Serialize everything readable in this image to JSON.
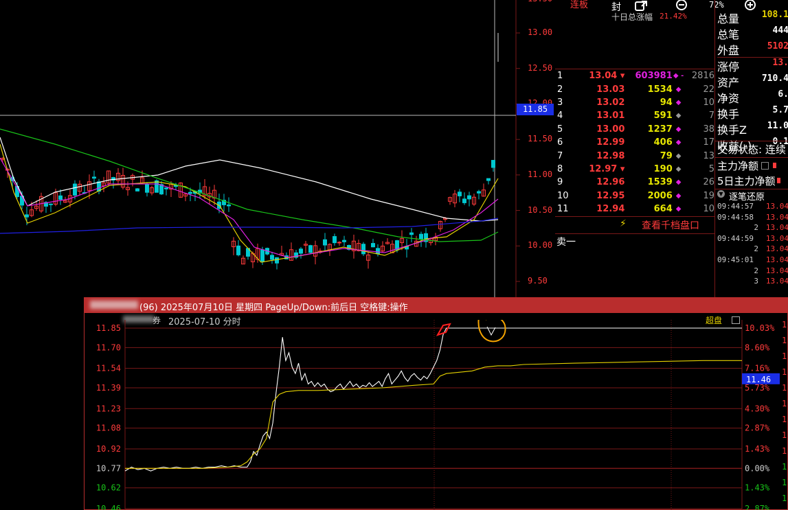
{
  "top_toolbar": {
    "seal_label": "封",
    "ten_day_label": "十日总涨幅",
    "ten_day_value": "21.42%",
    "zoom": "72%",
    "limit_up_tag": "连板"
  },
  "kline": {
    "y_ticks": [
      "13.00",
      "12.50",
      "12.00",
      "11.50",
      "11.00",
      "10.50",
      "10.00",
      "9.50"
    ],
    "cursor_price": "11.85",
    "top_cut_label": "13.50"
  },
  "order_book": {
    "rows": [
      {
        "idx": "1",
        "price": "13.04",
        "vol": "603981",
        "cnt": "2816",
        "highlight": true,
        "arrow": true
      },
      {
        "idx": "2",
        "price": "13.03",
        "vol": "1534",
        "cnt": "22"
      },
      {
        "idx": "3",
        "price": "13.02",
        "vol": "94",
        "cnt": "10"
      },
      {
        "idx": "4",
        "price": "13.01",
        "vol": "591",
        "cnt": "7"
      },
      {
        "idx": "5",
        "price": "13.00",
        "vol": "1237",
        "cnt": "38"
      },
      {
        "idx": "6",
        "price": "12.99",
        "vol": "406",
        "cnt": "17"
      },
      {
        "idx": "7",
        "price": "12.98",
        "vol": "79",
        "cnt": "13"
      },
      {
        "idx": "8",
        "price": "12.97",
        "vol": "190",
        "cnt": "5",
        "arrow": true
      },
      {
        "idx": "9",
        "price": "12.96",
        "vol": "1539",
        "cnt": "26"
      },
      {
        "idx": "10",
        "price": "12.95",
        "vol": "2006",
        "cnt": "19"
      },
      {
        "idx": "11",
        "price": "12.94",
        "vol": "664",
        "cnt": "10"
      }
    ],
    "view_depth_link": "查看千档盘口",
    "sell_one_label": "卖一"
  },
  "right_panel": {
    "rows": [
      {
        "label": "总量",
        "value": "108.1"
      },
      {
        "label": "总笔",
        "value": "444"
      },
      {
        "label": "外盘",
        "value": "5102"
      },
      {
        "label": "涨停",
        "value": "13."
      },
      {
        "label": "资产",
        "value": "710.4"
      },
      {
        "label": "净资",
        "value": "6."
      },
      {
        "label": "换手",
        "value": "5.7"
      },
      {
        "label": "换手Z",
        "value": "11.0"
      },
      {
        "label": "收益(-)",
        "value": "0.1"
      }
    ],
    "trade_status": "交易状态: 连续",
    "main_net": "主力净额",
    "main_net_5d": "5日主力净额",
    "tick_restore": "逐笔还原",
    "ticks": [
      {
        "time": "09:44:57",
        "price": "13.04"
      },
      {
        "time": "09:44:58",
        "price": "13.04"
      },
      {
        "time": "2",
        "price": "13.04"
      },
      {
        "time": "09:44:59",
        "price": "13.04"
      },
      {
        "time": "2",
        "price": "13.04"
      },
      {
        "time": "09:45:01",
        "price": "13.04"
      },
      {
        "time": "2",
        "price": "13.04"
      },
      {
        "time": "3",
        "price": "13.04"
      }
    ]
  },
  "popup": {
    "title": "(96) 2025年07月10日 星期四 PageUp/Down:前后日 空格键:操作",
    "subtitle_suffix": "券",
    "date_label": "2025-07-10 分时",
    "super_label": "超盘",
    "price_ticks": [
      "11.85",
      "11.70",
      "11.54",
      "11.39",
      "11.23",
      "11.08",
      "10.92",
      "10.77",
      "10.62",
      "10.46"
    ],
    "pct_ticks": [
      "10.03%",
      "8.60%",
      "7.16%",
      "5.73%",
      "4.30%",
      "2.87%",
      "1.43%",
      "0.00%",
      "1.43%",
      "2.87%"
    ],
    "last_price": "11.46",
    "right_edge_ticks": [
      "1",
      "1",
      "1",
      "1",
      "1",
      "1",
      "1",
      "1",
      "1",
      "1",
      "1",
      "1"
    ]
  },
  "chart_data": {
    "type": "line",
    "title": "2025-07-10 分时",
    "xlabel": "",
    "ylabel": "",
    "ylim": [
      10.46,
      11.85
    ],
    "prev_close": 10.77,
    "series": [
      {
        "name": "",
        "color": "#ffffff",
        "x": [
          0,
          10,
          20,
          30,
          40,
          50,
          60,
          70,
          80,
          90,
          100,
          110,
          120,
          130,
          140,
          150,
          160,
          170,
          180,
          190,
          195,
          200,
          205,
          210,
          215,
          220,
          225,
          230,
          235,
          240,
          245,
          250,
          255,
          260,
          265,
          270,
          275,
          280,
          285,
          290,
          295,
          300,
          305,
          310,
          315,
          320,
          325,
          330,
          335,
          340,
          345,
          350,
          355,
          360,
          365,
          370,
          375,
          380,
          385,
          390,
          395,
          400,
          405,
          410,
          415,
          420,
          425,
          430,
          435,
          440,
          445,
          450,
          455,
          460,
          465,
          470,
          475,
          480,
          485,
          490,
          495,
          500,
          505,
          510,
          515,
          520,
          525,
          530,
          535,
          540,
          545,
          550,
          555,
          560,
          565,
          570,
          575,
          580,
          585,
          590,
          595,
          600,
          610,
          620,
          630,
          640,
          650,
          660,
          670,
          680,
          690,
          700,
          710,
          720,
          730,
          740,
          750,
          760,
          770,
          780,
          790,
          800,
          810,
          820,
          830,
          840,
          850,
          860,
          870,
          880,
          890,
          900,
          910,
          920,
          930,
          940,
          950,
          960
        ],
        "y": [
          10.75,
          10.78,
          10.76,
          10.77,
          10.75,
          10.77,
          10.78,
          10.77,
          10.78,
          10.77,
          10.77,
          10.78,
          10.77,
          10.78,
          10.78,
          10.79,
          10.78,
          10.79,
          10.78,
          10.78,
          10.82,
          10.9,
          10.87,
          10.95,
          11.02,
          11.05,
          11.0,
          11.12,
          11.35,
          11.55,
          11.78,
          11.6,
          11.66,
          11.55,
          11.5,
          11.58,
          11.45,
          11.5,
          11.42,
          11.44,
          11.4,
          11.43,
          11.4,
          11.42,
          11.38,
          11.36,
          11.37,
          11.4,
          11.42,
          11.38,
          11.41,
          11.44,
          11.4,
          11.42,
          11.39,
          11.41,
          11.4,
          11.43,
          11.4,
          11.42,
          11.44,
          11.4,
          11.46,
          11.5,
          11.42,
          11.45,
          11.48,
          11.52,
          11.47,
          11.44,
          11.48,
          11.5,
          11.47,
          11.45,
          11.48,
          11.46,
          11.5,
          11.55,
          11.6,
          11.68,
          11.8,
          11.85,
          11.85,
          11.85,
          11.85,
          11.85,
          11.85,
          11.85,
          11.85,
          11.85,
          11.85,
          11.85,
          11.85,
          11.85,
          11.85,
          11.85,
          11.85,
          11.85,
          11.85,
          11.85,
          11.85,
          11.85,
          11.85,
          11.85,
          11.85,
          11.85,
          11.85,
          11.85,
          11.85,
          11.85,
          11.85,
          11.85,
          11.85,
          11.85,
          11.85,
          11.85,
          11.85,
          11.85,
          11.85,
          11.85,
          11.85,
          11.85,
          11.85,
          11.85,
          11.85,
          11.85,
          11.85,
          11.85,
          11.85,
          11.85,
          11.85,
          11.85,
          11.85,
          11.85,
          11.85,
          11.85,
          11.85,
          11.85
        ]
      },
      {
        "name": "",
        "color": "#e6d200",
        "x": [
          0,
          40,
          80,
          120,
          160,
          180,
          190,
          200,
          210,
          220,
          230,
          240,
          250,
          270,
          300,
          350,
          400,
          450,
          480,
          490,
          500,
          520,
          540,
          560,
          580,
          600,
          620,
          700,
          800,
          900,
          960
        ],
        "y": [
          10.77,
          10.77,
          10.77,
          10.77,
          10.78,
          10.79,
          10.82,
          10.88,
          10.92,
          11.0,
          11.28,
          11.34,
          11.36,
          11.37,
          11.37,
          11.38,
          11.39,
          11.41,
          11.42,
          11.48,
          11.5,
          11.51,
          11.52,
          11.55,
          11.56,
          11.56,
          11.57,
          11.58,
          11.59,
          11.6,
          11.6
        ]
      }
    ]
  },
  "colors": {
    "popup_bar": "#b92d2d",
    "up": "#ff3b3b",
    "down": "#00c8d0",
    "grid": "#7a1818",
    "cursor": "#1a2ee6"
  }
}
